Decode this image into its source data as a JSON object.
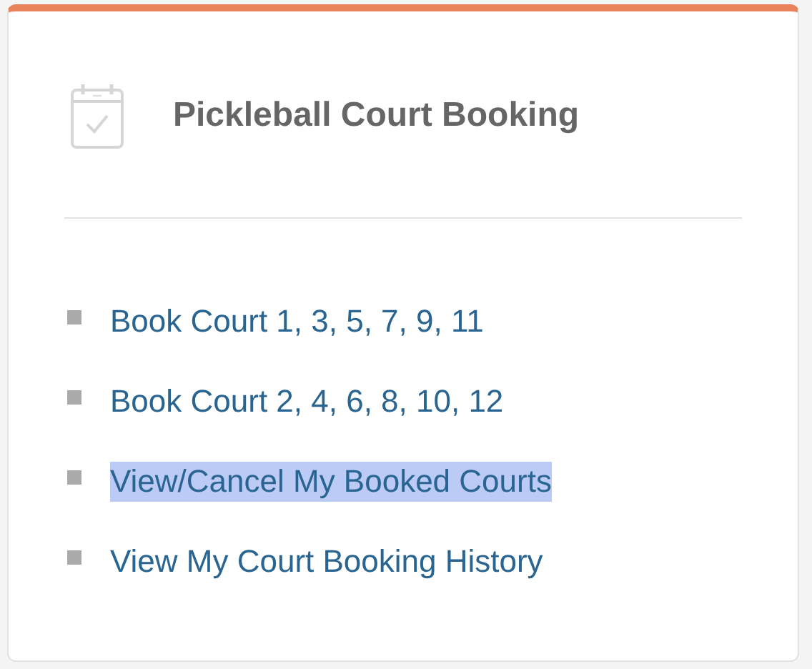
{
  "card": {
    "title": "Pickleball Court Booking"
  },
  "links": [
    {
      "label": "Book Court 1, 3, 5, 7, 9, 11",
      "selected": false
    },
    {
      "label": "Book Court 2, 4, 6, 8, 10, 12",
      "selected": false
    },
    {
      "label": "View/Cancel My Booked Courts",
      "selected": true
    },
    {
      "label": "View My Court Booking History",
      "selected": false
    }
  ]
}
